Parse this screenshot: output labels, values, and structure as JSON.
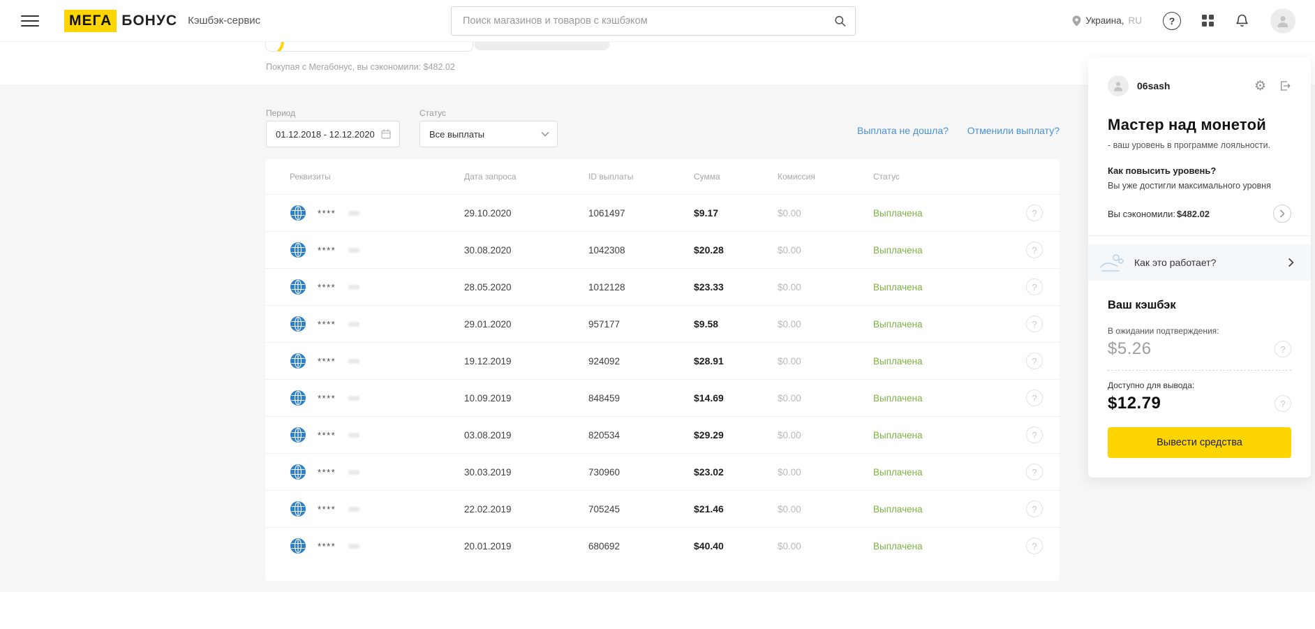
{
  "brand": {
    "mega": "МЕГА",
    "bonus": "БОНУС",
    "tagline": "Кэшбэк-сервис"
  },
  "header": {
    "search_placeholder": "Поиск магазинов и товаров с кэшбэком",
    "region_primary": "Украина,",
    "region_secondary": "RU"
  },
  "subheader": {
    "savings_note": "Покупая с Мегабонус, вы сэкономили: $482.02"
  },
  "filters": {
    "period_label": "Период",
    "period_value": "01.12.2018 - 12.12.2020",
    "status_label": "Статус",
    "status_value": "Все выплаты",
    "link_not_received": "Выплата не дошла?",
    "link_cancelled": "Отменили выплату?"
  },
  "table": {
    "headers": [
      "Реквизиты",
      "Дата запроса",
      "ID выплаты",
      "Сумма",
      "Комиссия",
      "Статус"
    ],
    "rows": [
      {
        "requisites": "****",
        "date": "29.10.2020",
        "id": "1061497",
        "amount": "$9.17",
        "fee": "$0.00",
        "status": "Выплачена"
      },
      {
        "requisites": "****",
        "date": "30.08.2020",
        "id": "1042308",
        "amount": "$20.28",
        "fee": "$0.00",
        "status": "Выплачена"
      },
      {
        "requisites": "****",
        "date": "28.05.2020",
        "id": "1012128",
        "amount": "$23.33",
        "fee": "$0.00",
        "status": "Выплачена"
      },
      {
        "requisites": "****",
        "date": "29.01.2020",
        "id": "957177",
        "amount": "$9.58",
        "fee": "$0.00",
        "status": "Выплачена"
      },
      {
        "requisites": "****",
        "date": "19.12.2019",
        "id": "924092",
        "amount": "$28.91",
        "fee": "$0.00",
        "status": "Выплачена"
      },
      {
        "requisites": "****",
        "date": "10.09.2019",
        "id": "848459",
        "amount": "$14.69",
        "fee": "$0.00",
        "status": "Выплачена"
      },
      {
        "requisites": "****",
        "date": "03.08.2019",
        "id": "820534",
        "amount": "$29.29",
        "fee": "$0.00",
        "status": "Выплачена"
      },
      {
        "requisites": "****",
        "date": "30.03.2019",
        "id": "730960",
        "amount": "$23.02",
        "fee": "$0.00",
        "status": "Выплачена"
      },
      {
        "requisites": "****",
        "date": "22.02.2019",
        "id": "705245",
        "amount": "$21.46",
        "fee": "$0.00",
        "status": "Выплачена"
      },
      {
        "requisites": "****",
        "date": "20.01.2019",
        "id": "680692",
        "amount": "$40.40",
        "fee": "$0.00",
        "status": "Выплачена"
      }
    ]
  },
  "sidebar": {
    "username": "06sash",
    "level_title": "Мастер над монетой",
    "level_subtitle": "- ваш уровень в программе лояльности.",
    "level_up_question": "Как повысить уровень?",
    "level_up_answer": "Вы уже достигли максимального уровня",
    "saved_label": "Вы сэкономили:",
    "saved_value": "$482.02",
    "how_it_works": "Как это работает?",
    "cashback_title": "Ваш кэшбэк",
    "pending_label": "В ожидании подтверждения:",
    "pending_value": "$5.26",
    "available_label": "Доступно для вывода:",
    "available_value": "$12.79",
    "withdraw_button": "Вывести средства"
  },
  "icons": {
    "help": "?",
    "gear": "⚙"
  },
  "colors": {
    "brand_yellow": "#FFD500",
    "status_green": "#7CB342",
    "link_blue": "#4A90D2",
    "page_gray": "#F6F6F7"
  }
}
